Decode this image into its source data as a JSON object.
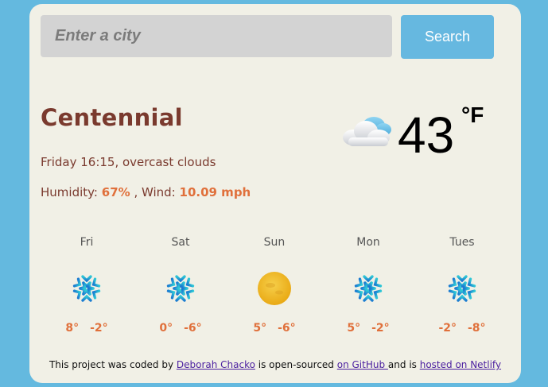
{
  "search": {
    "placeholder": "Enter a city",
    "button_label": "Search"
  },
  "current": {
    "city": "Centennial",
    "datetime_text": "Friday 16:15, overcast clouds",
    "humidity_label": "Humidity:",
    "humidity_value": "67%",
    "wind_label": " , Wind:",
    "wind_value": "10.09 mph",
    "temperature": "43",
    "unit": "°F",
    "icon": "cloud-icon"
  },
  "forecast": [
    {
      "day": "Fri",
      "icon": "snowflake-icon",
      "max": "8°",
      "min": "-2°"
    },
    {
      "day": "Sat",
      "icon": "snowflake-icon",
      "max": "0°",
      "min": "-6°"
    },
    {
      "day": "Sun",
      "icon": "sun-icon",
      "max": "5°",
      "min": "-6°"
    },
    {
      "day": "Mon",
      "icon": "snowflake-icon",
      "max": "5°",
      "min": "-2°"
    },
    {
      "day": "Tues",
      "icon": "snowflake-icon",
      "max": "-2°",
      "min": "-8°"
    }
  ],
  "footer": {
    "text_1": "This project was coded by ",
    "author_link": "Deborah Chacko",
    "text_2": " is open-sourced ",
    "github_link": "on GitHub ",
    "text_3": "and is ",
    "netlify_link": "hosted on Netlify"
  },
  "colors": {
    "background": "#64b9df",
    "card": "#f1f0e6",
    "accent": "#e0703b",
    "city": "#7a3a2e",
    "button": "#66b8e0"
  }
}
